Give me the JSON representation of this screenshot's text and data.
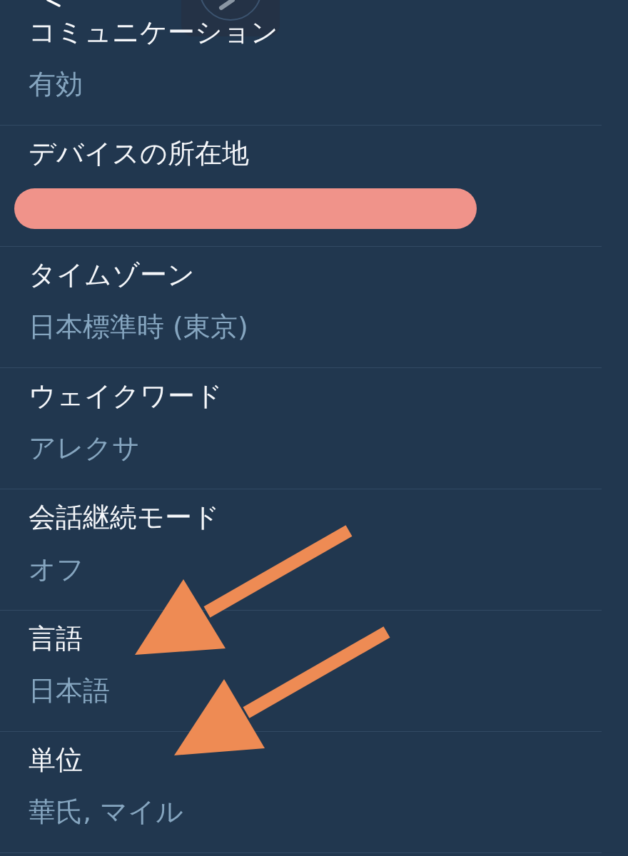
{
  "rows": [
    {
      "kind": "text",
      "title": "コミュニケーション",
      "value": "有効"
    },
    {
      "kind": "redacted",
      "title": "デバイスの所在地"
    },
    {
      "kind": "text",
      "title": "タイムゾーン",
      "value": "日本標準時 (東京)"
    },
    {
      "kind": "text",
      "title": "ウェイクワード",
      "value": "アレクサ"
    },
    {
      "kind": "text",
      "title": "会話継続モード",
      "value": "オフ"
    },
    {
      "kind": "text",
      "title": "言語",
      "value": "日本語"
    },
    {
      "kind": "text",
      "title": "単位",
      "value": "華氏, マイル"
    }
  ]
}
